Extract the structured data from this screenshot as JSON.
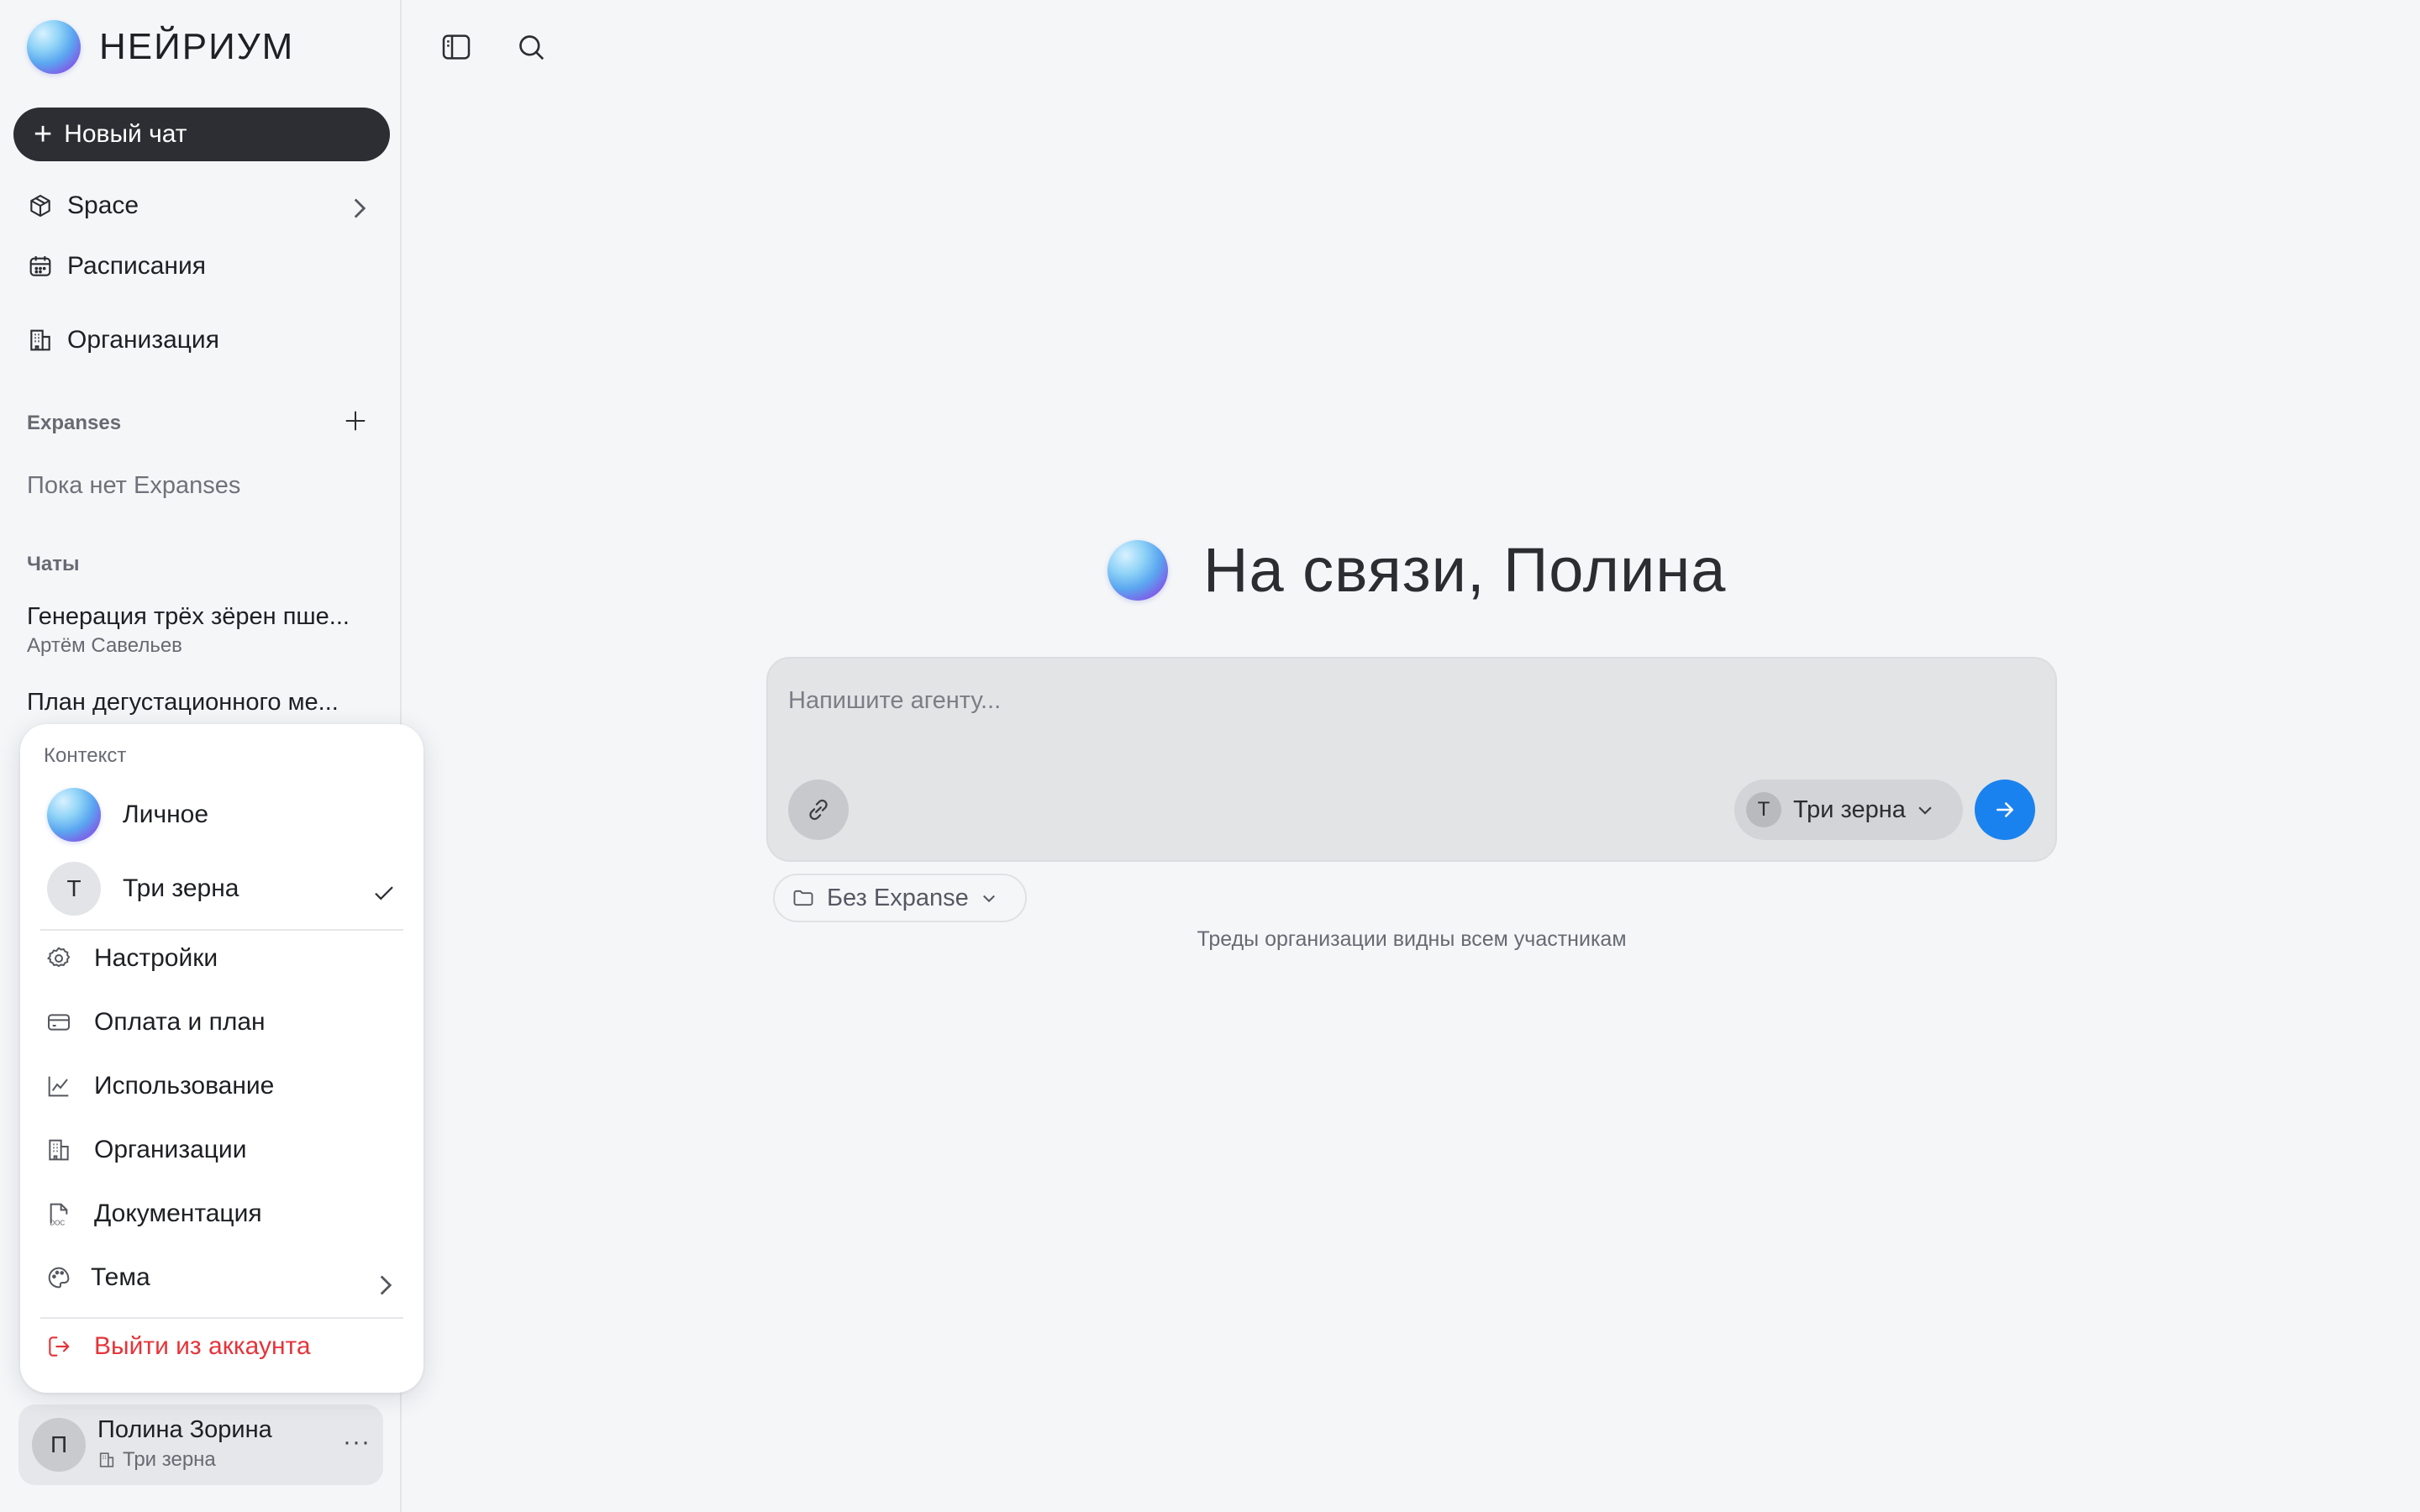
{
  "app": {
    "brand": "НЕЙРИУМ"
  },
  "sidebar": {
    "new_chat_label": "Новый чат",
    "nav": [
      {
        "label": "Space",
        "icon": "cube-icon"
      },
      {
        "label": "Расписания",
        "icon": "calendar-icon"
      },
      {
        "label": "Организация",
        "icon": "building-icon"
      }
    ],
    "expanses_label": "Expanses",
    "expanses_empty": "Пока нет Expanses",
    "chats_label": "Чаты",
    "chats": [
      {
        "title": "Генерация трёх зёрен пше...",
        "author": "Артём Савельев"
      },
      {
        "title": "План дегустационного ме..."
      }
    ]
  },
  "account_menu": {
    "context_label": "Контекст",
    "contexts": [
      {
        "label": "Личное",
        "avatar": "orb"
      },
      {
        "label": "Три зерна",
        "avatar_letter": "Т",
        "selected": true
      }
    ],
    "items": [
      {
        "label": "Настройки",
        "icon": "gear-icon"
      },
      {
        "label": "Оплата и план",
        "icon": "credit-card-icon"
      },
      {
        "label": "Использование",
        "icon": "chart-line-icon"
      },
      {
        "label": "Организации",
        "icon": "building-icon"
      },
      {
        "label": "Документация",
        "icon": "doc-file-icon"
      },
      {
        "label": "Тема",
        "icon": "palette-icon"
      }
    ],
    "logout_label": "Выйти из аккаунта"
  },
  "user": {
    "avatar_letter": "П",
    "name": "Полина Зорина",
    "org": "Три зерна"
  },
  "main": {
    "greeting": "На связи, Полина",
    "composer": {
      "placeholder": "Напишите агенту...",
      "org_badge_letter": "Т",
      "org_label": "Три зерна"
    },
    "expanse_selector": "Без Expanse",
    "visibility_note": "Треды организации видны всем участникам"
  },
  "colors": {
    "accent": "#1a82ee",
    "danger": "#e5343a",
    "new_chat_bg": "#2c2e33",
    "background": "#f5f6f8"
  }
}
